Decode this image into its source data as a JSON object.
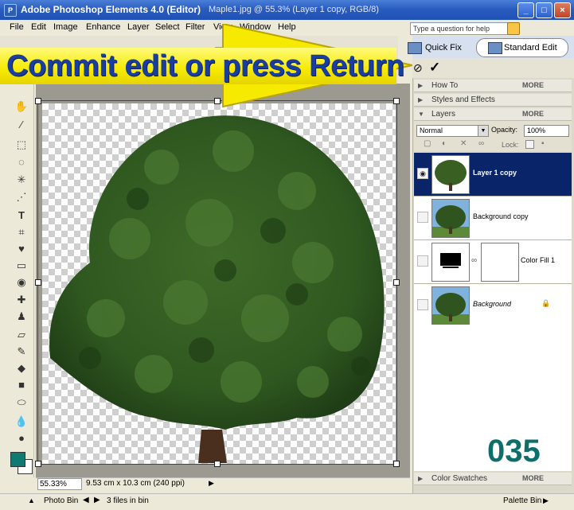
{
  "window": {
    "app_title": "Adobe Photoshop Elements 4.0 (Editor)",
    "doc_title": "Maple1.jpg @ 55.3% (Layer 1 copy, RGB/8)",
    "minimize": "_",
    "maximize": "□",
    "close": "×"
  },
  "menu": {
    "items": [
      "File",
      "Edit",
      "Image",
      "Enhance",
      "Layer",
      "Select",
      "Filter",
      "View",
      "Window",
      "Help"
    ],
    "help_placeholder": "Type a question for help"
  },
  "modes": {
    "quick_fix": "Quick Fix",
    "standard_edit": "Standard Edit"
  },
  "options": {
    "cancel_symbol": "⊘",
    "commit_symbol": "✓"
  },
  "callout": {
    "text": "Commit edit or press Return",
    "arrow_color": "#f6ea00"
  },
  "palettes": {
    "how_to": "How To",
    "styles": "Styles and Effects",
    "layers": "Layers",
    "color_swatches": "Color Swatches",
    "more": "MORE"
  },
  "layers": {
    "blend_mode": "Normal",
    "opacity_label": "Opacity:",
    "opacity": "100%",
    "lock_label": "Lock:",
    "rows": [
      {
        "name": "Layer 1 copy"
      },
      {
        "name": "Background copy"
      },
      {
        "name": "Color Fill 1"
      },
      {
        "name": "Background"
      }
    ]
  },
  "status": {
    "zoom": "55.33%",
    "doc_size": "9.53 cm x 10.3 cm (240 ppi)"
  },
  "bottombar": {
    "photo_bin": "Photo Bin",
    "files_in_bin": "3 files in bin",
    "palette_bin": "Palette Bin"
  },
  "watermark": "035",
  "colors": {
    "foreground": "#0f7a72",
    "background": "#ffffff",
    "selected_layer": "#0a246a"
  }
}
